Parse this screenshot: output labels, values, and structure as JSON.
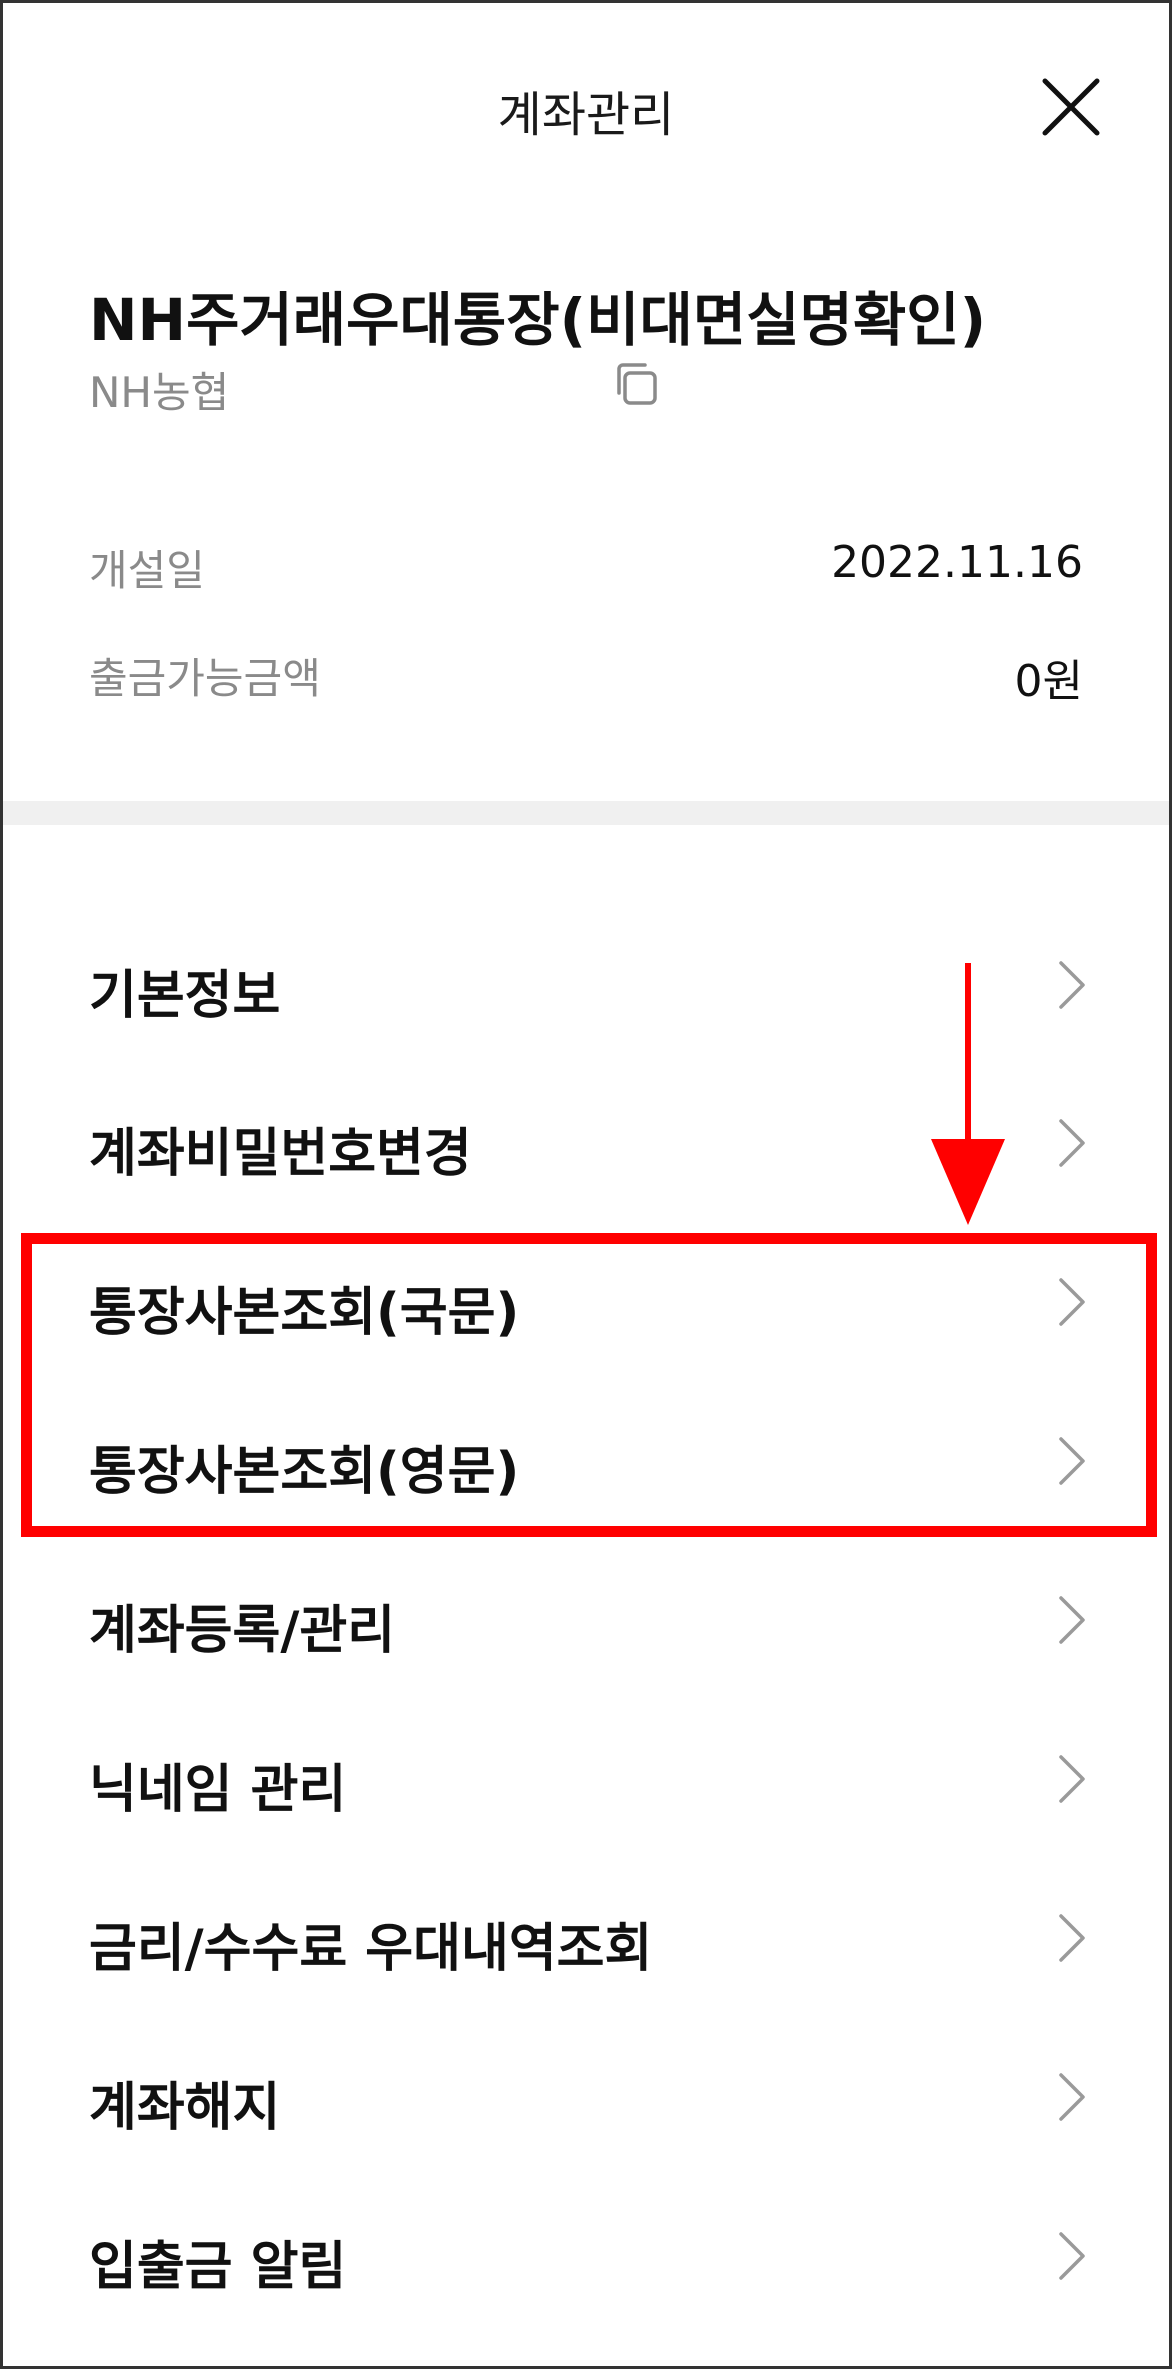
{
  "header": {
    "title": "계좌관리",
    "close_icon": "close-icon"
  },
  "account": {
    "name": "NH주거래우대통장(비대면실명확인)",
    "bank": "NH농협",
    "copy_icon": "copy-icon"
  },
  "info": {
    "open_date_label": "개설일",
    "open_date_value": "2022.11.16",
    "withdrawable_label": "출금가능금액",
    "withdrawable_value": "0원"
  },
  "menu": {
    "items": [
      {
        "label": "기본정보"
      },
      {
        "label": "계좌비밀번호변경"
      },
      {
        "label": "통장사본조회(국문)"
      },
      {
        "label": "통장사본조회(영문)"
      },
      {
        "label": "계좌등록/관리"
      },
      {
        "label": "닉네임 관리"
      },
      {
        "label": "금리/수수료 우대내역조회"
      },
      {
        "label": "계좌해지"
      },
      {
        "label": "입출금 알림"
      }
    ]
  },
  "annotation": {
    "highlight_color": "#ff0000",
    "arrow_color": "#ff0000"
  }
}
